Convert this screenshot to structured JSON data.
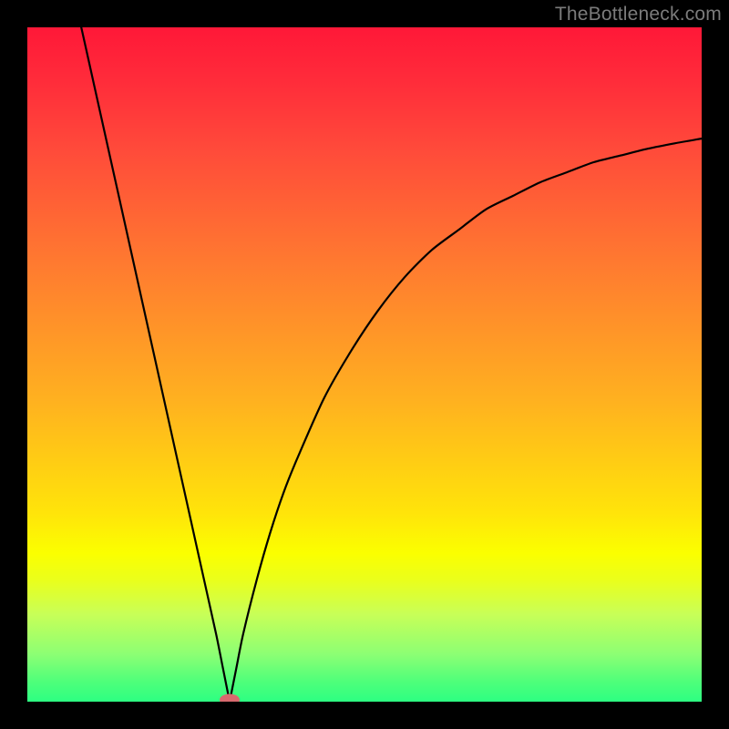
{
  "watermark": "TheBottleneck.com",
  "chart_data": {
    "type": "line",
    "title": "",
    "xlabel": "",
    "ylabel": "",
    "xlim": [
      0,
      100
    ],
    "ylim": [
      0,
      100
    ],
    "x": [
      8,
      10,
      12,
      14,
      16,
      18,
      20,
      22,
      24,
      26,
      28,
      29,
      30,
      31,
      32,
      34,
      36,
      38,
      40,
      44,
      48,
      52,
      56,
      60,
      64,
      68,
      72,
      76,
      80,
      84,
      88,
      92,
      96,
      100
    ],
    "values": [
      100,
      91,
      82,
      73,
      64,
      55,
      46,
      37,
      28,
      19,
      10,
      5,
      0,
      5,
      10,
      18,
      25,
      31,
      36,
      45,
      52,
      58,
      63,
      67,
      70,
      73,
      75,
      77,
      78.5,
      80,
      81,
      82,
      82.8,
      83.5
    ],
    "min_marker": {
      "x": 30,
      "y": 0
    },
    "gradient_stops": [
      {
        "pos": 0,
        "color": "#ff1838"
      },
      {
        "pos": 55,
        "color": "#ffb020"
      },
      {
        "pos": 78,
        "color": "#fbff00"
      },
      {
        "pos": 100,
        "color": "#2dff82"
      }
    ]
  }
}
